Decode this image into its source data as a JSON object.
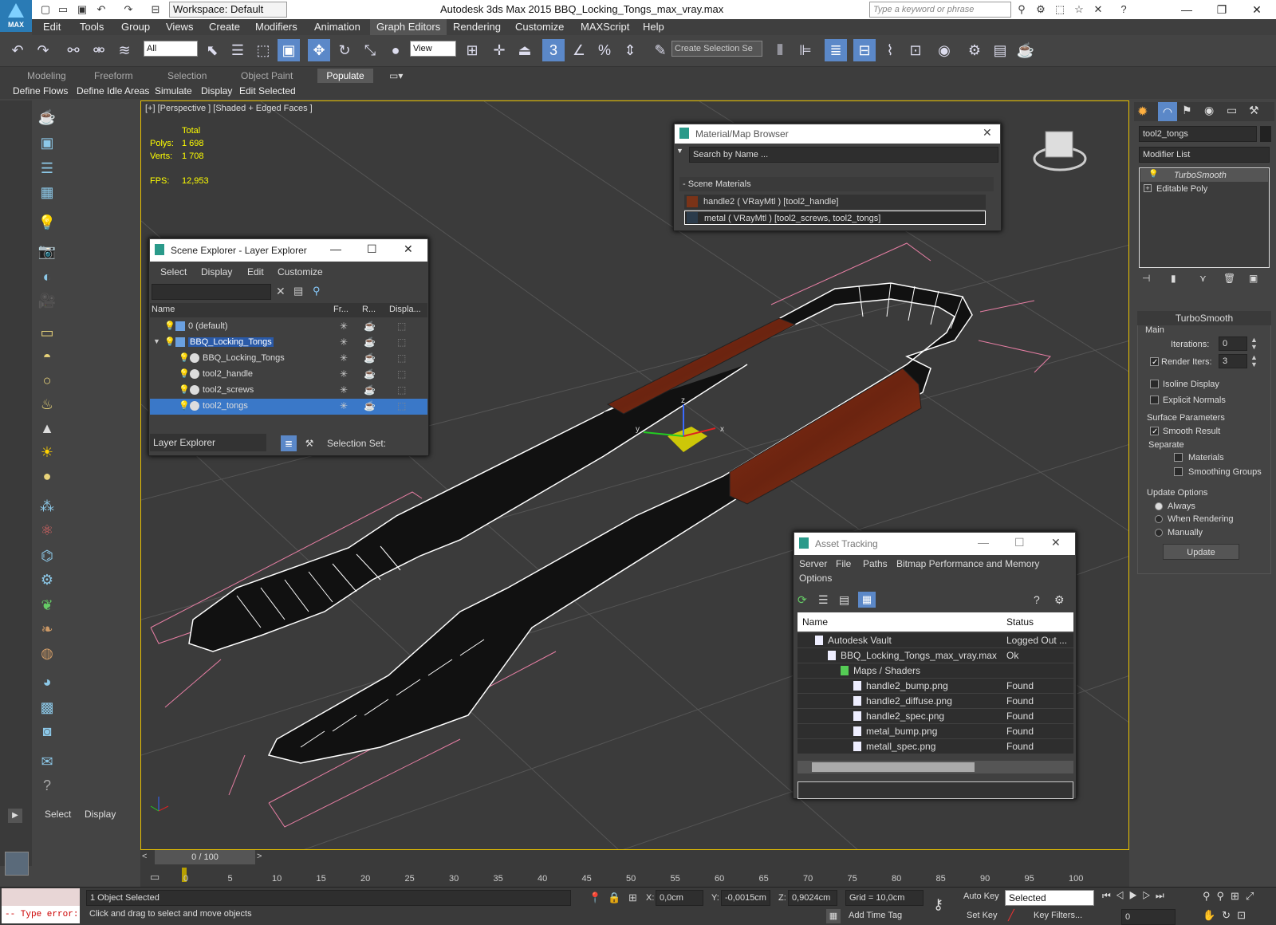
{
  "titlebar": {
    "workspace": "Workspace: Default",
    "title": "Autodesk 3ds Max  2015     BBQ_Locking_Tongs_max_vray.max",
    "search_placeholder": "Type a keyword or phrase",
    "logo_text": "MAX"
  },
  "menu": [
    "Edit",
    "Tools",
    "Group",
    "Views",
    "Create",
    "Modifiers",
    "Animation",
    "Graph Editors",
    "Rendering",
    "Customize",
    "MAXScript",
    "Help"
  ],
  "toolbar": {
    "filter": "All",
    "refcoord": "View",
    "selection_set": "Create Selection Se",
    "snap_label": "3"
  },
  "ribbon": {
    "tabs": [
      "Modeling",
      "Freeform",
      "Selection",
      "Object Paint"
    ],
    "active": "Populate",
    "sub": [
      "Define Flows",
      "Define Idle Areas",
      "Simulate",
      "Display",
      "Edit Selected"
    ]
  },
  "viewport": {
    "label": "[+] [Perspective ] [Shaded + Edged Faces ]",
    "total_label": "Total",
    "polys_label": "Polys:",
    "polys": "1 698",
    "verts_label": "Verts:",
    "verts": "1 708",
    "fps_label": "FPS:",
    "fps": "12,953",
    "gizmo_x": "x",
    "gizmo_y": "y",
    "gizmo_z": "z"
  },
  "material_browser": {
    "title": "Material/Map Browser",
    "search": "Search by Name ...",
    "group": "- Scene Materials",
    "items": [
      "handle2  ( VRayMtl ) [tool2_handle]",
      "metal  ( VRayMtl ) [tool2_screws, tool2_tongs]"
    ]
  },
  "scene_explorer": {
    "title": "Scene Explorer - Layer Explorer",
    "menu": [
      "Select",
      "Display",
      "Edit",
      "Customize"
    ],
    "cols": [
      "Name",
      "Fr...",
      "R...",
      "Displa..."
    ],
    "rows": [
      {
        "name": "0 (default)",
        "indent": 0
      },
      {
        "name": "BBQ_Locking_Tongs",
        "indent": 0
      },
      {
        "name": "BBQ_Locking_Tongs",
        "indent": 1
      },
      {
        "name": "tool2_handle",
        "indent": 1
      },
      {
        "name": "tool2_screws",
        "indent": 1
      },
      {
        "name": "tool2_tongs",
        "indent": 1
      }
    ],
    "footer_dropdown": "Layer Explorer",
    "selection_set": "Selection Set:"
  },
  "asset_tracking": {
    "title": "Asset Tracking",
    "menu": [
      "Server",
      "File",
      "Paths",
      "Bitmap Performance and Memory",
      "Options"
    ],
    "cols": [
      "Name",
      "Status"
    ],
    "rows": [
      {
        "name": "Autodesk Vault",
        "status": "Logged Out ...",
        "indent": 1
      },
      {
        "name": "BBQ_Locking_Tongs_max_vray.max",
        "status": "Ok",
        "indent": 2
      },
      {
        "name": "Maps / Shaders",
        "status": "",
        "indent": 3
      },
      {
        "name": "handle2_bump.png",
        "status": "Found",
        "indent": 4
      },
      {
        "name": "handle2_diffuse.png",
        "status": "Found",
        "indent": 4
      },
      {
        "name": "handle2_spec.png",
        "status": "Found",
        "indent": 4
      },
      {
        "name": "metal_bump.png",
        "status": "Found",
        "indent": 4
      },
      {
        "name": "metall_spec.png",
        "status": "Found",
        "indent": 4
      }
    ]
  },
  "modifier_panel": {
    "object_name": "tool2_tongs",
    "modifier_list": "Modifier List",
    "stack": [
      "TurboSmooth",
      "Editable Poly"
    ],
    "rollout": "TurboSmooth",
    "main": "Main",
    "iterations_label": "Iterations:",
    "iterations": "0",
    "render_iters_label": "Render Iters:",
    "render_iters": "3",
    "isoline": "Isoline Display",
    "explicit": "Explicit Normals",
    "surface": "Surface Parameters",
    "smooth_result": "Smooth Result",
    "separate": "Separate",
    "materials": "Materials",
    "smoothing_groups": "Smoothing Groups",
    "update_options": "Update Options",
    "always": "Always",
    "when_rendering": "When Rendering",
    "manually": "Manually",
    "update_btn": "Update"
  },
  "left_bottom": {
    "select": "Select",
    "display": "Display"
  },
  "timeline": {
    "frame": "0 / 100",
    "ticks": [
      "0",
      "5",
      "10",
      "15",
      "20",
      "25",
      "30",
      "35",
      "40",
      "45",
      "50",
      "55",
      "60",
      "65",
      "70",
      "75",
      "80",
      "85",
      "90",
      "95",
      "100"
    ]
  },
  "status": {
    "script_error": "-- Type error:",
    "selected": "1 Object Selected",
    "prompt": "Click and drag to select and move objects",
    "x_label": "X:",
    "x": "0,0cm",
    "y_label": "Y:",
    "y": "-0,0015cm",
    "z_label": "Z:",
    "z": "0,9024cm",
    "grid": "Grid = 10,0cm",
    "auto_key": "Auto Key",
    "set_key": "Set Key",
    "key_mode": "Selected",
    "add_time_tag": "Add Time Tag",
    "key_filters": "Key Filters...",
    "frame": "0"
  }
}
